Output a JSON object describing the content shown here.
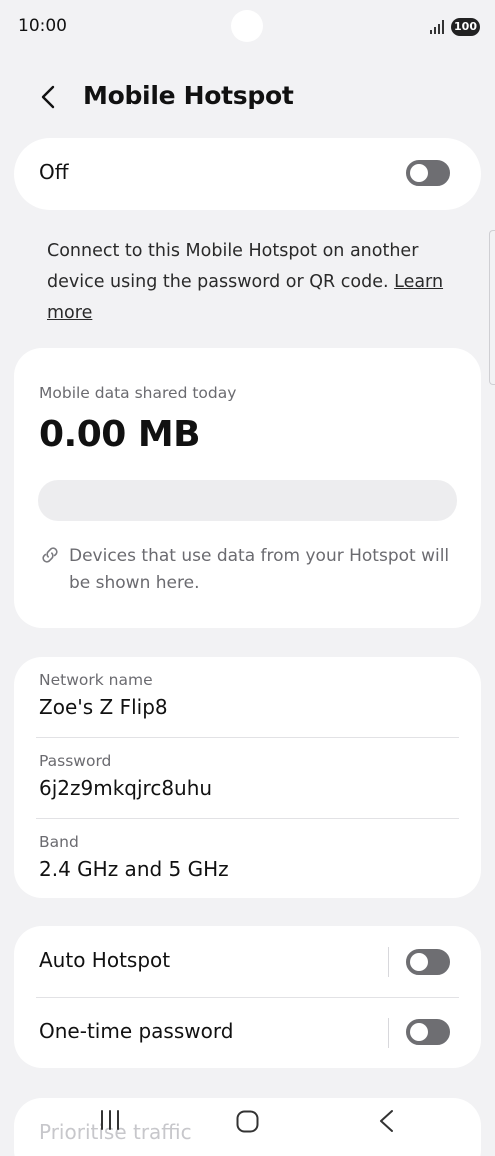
{
  "status_bar": {
    "time": "10:00",
    "battery": "100",
    "icons": [
      "signal-icon",
      "battery-icon"
    ]
  },
  "header": {
    "title": "Mobile Hotspot",
    "back_icon": "back-arrow-icon"
  },
  "master_switch": {
    "label": "Off",
    "state": "off"
  },
  "description": {
    "text": "Connect to this Mobile Hotspot on another device using the password or QR code.",
    "link": "Learn more"
  },
  "usage": {
    "label": "Mobile data shared today",
    "value": "0.00 MB",
    "note": "Devices that use data from your Hotspot will be shown here.",
    "note_icon": "link-icon"
  },
  "network": {
    "name_label": "Network name",
    "name_value": "Zoe's Z Flip8",
    "password_label": "Password",
    "password_value": "6j2z9mkqjrc8uhu",
    "band_label": "Band",
    "band_value": "2.4 GHz and 5 GHz"
  },
  "switches": {
    "auto_hotspot": {
      "label": "Auto Hotspot",
      "state": "off"
    },
    "one_time_password": {
      "label": "One-time password",
      "state": "off"
    }
  },
  "peek": {
    "label": "Prioritise traffic"
  },
  "nav_bar": {
    "icons": [
      "recent-apps-icon",
      "home-icon",
      "back-icon"
    ]
  },
  "colors": {
    "background": "#f2f2f4",
    "card": "#ffffff",
    "toggle_off": "#6e6e72",
    "secondary_text": "#6b6b70"
  }
}
